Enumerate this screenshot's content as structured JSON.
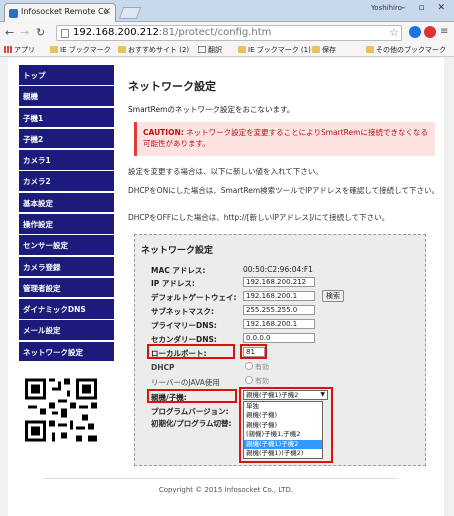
{
  "browser": {
    "tab_title": "Infosocket Remote Co",
    "user_label": "Yoshihiro",
    "window_controls": "– ▫ ✕",
    "url_host": "192.168.200.212",
    "url_rest": ":81/protect/config.htm",
    "bookmarks": [
      {
        "label": "アプリ",
        "icon": "apps-icon"
      },
      {
        "label": "IE ブックマーク",
        "icon": "folder-icon"
      },
      {
        "label": "おすすめサイト (2)",
        "icon": "folder-icon"
      },
      {
        "label": "翻訳",
        "icon": "page-icon"
      },
      {
        "label": "IE ブックマーク (1)",
        "icon": "folder-icon"
      },
      {
        "label": "保存",
        "icon": "folder-icon"
      },
      {
        "label": "その他のブックマーク",
        "icon": "folder-icon"
      }
    ]
  },
  "sidebar": {
    "items": [
      "トップ",
      "親機",
      "子機1",
      "子機2",
      "カメラ1",
      "カメラ2",
      "基本設定",
      "操作設定",
      "センサー設定",
      "カメラ登録",
      "管理者設定",
      "ダイナミックDNS",
      "メール設定",
      "ネットワーク設定"
    ],
    "active_index": 13,
    "qr_icon": "qr-code-icon"
  },
  "main": {
    "title": "ネットワーク設定",
    "intro": "SmartRemのネットワーク設定をおこないます。",
    "caution_label": "CAUTION:",
    "caution_text": "ネットワーク設定を変更することによりSmartRemに接続できなくなる可能性があります。",
    "para1": "設定を変更する場合は、以下に新しい値を入れて下さい。",
    "para2": "DHCPをONにした場合は、SmartRem検索ツールでIPアドレスを確認して接続して下さい。",
    "para3": "DHCPをOFFにした場合は、http://[新しいIPアドレス]/にて接続して下さい。"
  },
  "form": {
    "title": "ネットワーク設定",
    "mac_label": "MAC アドレス:",
    "mac_value": "00:50:C2:96:04:F1",
    "ip_label": "IP アドレス:",
    "ip_value": "192.168.200.212",
    "gateway_label": "デフォルトゲートウェイ:",
    "gateway_value": "192.168.200.1",
    "gateway_button": "検索",
    "subnet_label": "サブネットマスク:",
    "subnet_value": "255.255.255.0",
    "dns1_label": "プライマリーDNS:",
    "dns1_value": "192.168.200.1",
    "dns2_label": "セカンダリーDNS:",
    "dns2_value": "0.0.0.0",
    "port_label": "ローカルポート:",
    "port_value": "81",
    "dhcp_label": "DHCP",
    "dhcp_option": "有効",
    "java_label": "リーバーのJAVA使用",
    "java_option": "有効",
    "mode_label": "親機/子機:",
    "mode_selected": "親機(子機1)子機2",
    "mode_options": [
      "単独",
      "親機(子機)",
      "親機(子機)",
      "(親機)子機1,子機2",
      "親機(子機1)子機2",
      "親機(子機1)(子機2)"
    ],
    "mode_highlight_index": 4,
    "firmware_label": "プログラムバージョン:",
    "init_label": "初期化/プログラム切替:"
  },
  "footer": "Copyright © 2015 Infosocket Co., LTD.",
  "colors": {
    "sidebar_bg": "#1b1b7c",
    "caution_bg": "#fde2e2",
    "highlight": "#e01010",
    "selection": "#3399ff"
  }
}
